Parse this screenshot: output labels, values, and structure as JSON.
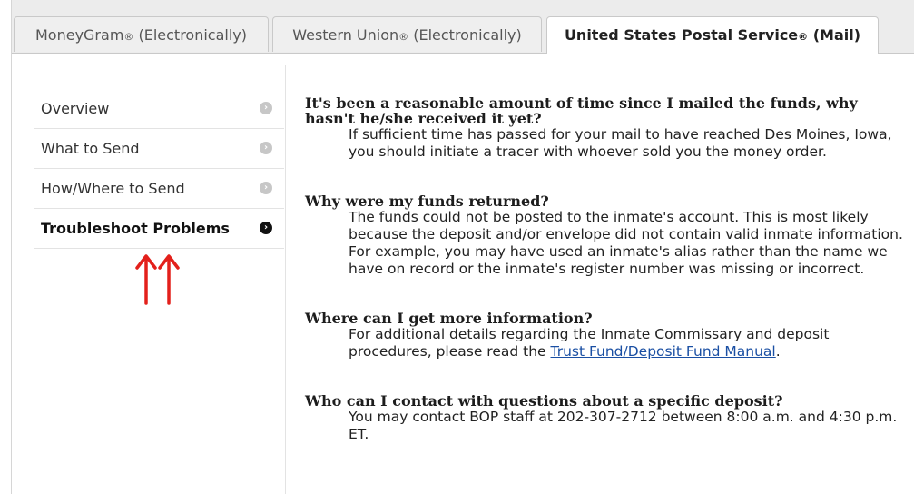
{
  "tabs": [
    {
      "label": "MoneyGram",
      "reg": "®",
      "suffix": " (Electronically)"
    },
    {
      "label": "Western Union",
      "reg": "®",
      "suffix": " (Electronically)"
    },
    {
      "label": "United States Postal Service",
      "reg": "®",
      "suffix": " (Mail)"
    }
  ],
  "sidebar": {
    "items": [
      {
        "label": "Overview",
        "icon": "chevron-right-circle-icon"
      },
      {
        "label": "What to Send",
        "icon": "chevron-right-circle-icon"
      },
      {
        "label": "How/Where to Send",
        "icon": "chevron-right-circle-icon"
      },
      {
        "label": "Troubleshoot Problems",
        "icon": "chevron-right-circle-icon"
      }
    ],
    "annotation_color": "#e3201b"
  },
  "faq": [
    {
      "question": "It's been a reasonable amount of time since I mailed the funds, why hasn't he/she received it yet?",
      "answer": "If sufficient time has passed for your mail to have reached Des Moines, Iowa, you should initiate a tracer with whoever sold you the money order."
    },
    {
      "question": "Why were my funds returned?",
      "answer": "The funds could not be posted to the inmate's account. This is most likely because the deposit and/or envelope did not contain valid inmate information. For example, you may have used an inmate's alias rather than the name we have on record or the inmate's register number was missing or incorrect."
    },
    {
      "question": "Where can I get more information?",
      "answer_before": "For additional details regarding the Inmate Commissary and deposit procedures, please read the ",
      "link_text": "Trust Fund/Deposit Fund Manual",
      "answer_after": "."
    },
    {
      "question": "Who can I contact with questions about a specific deposit?",
      "answer": "You may contact BOP staff at 202-307-2712 between 8:00 a.m. and 4:30 p.m. ET."
    }
  ]
}
